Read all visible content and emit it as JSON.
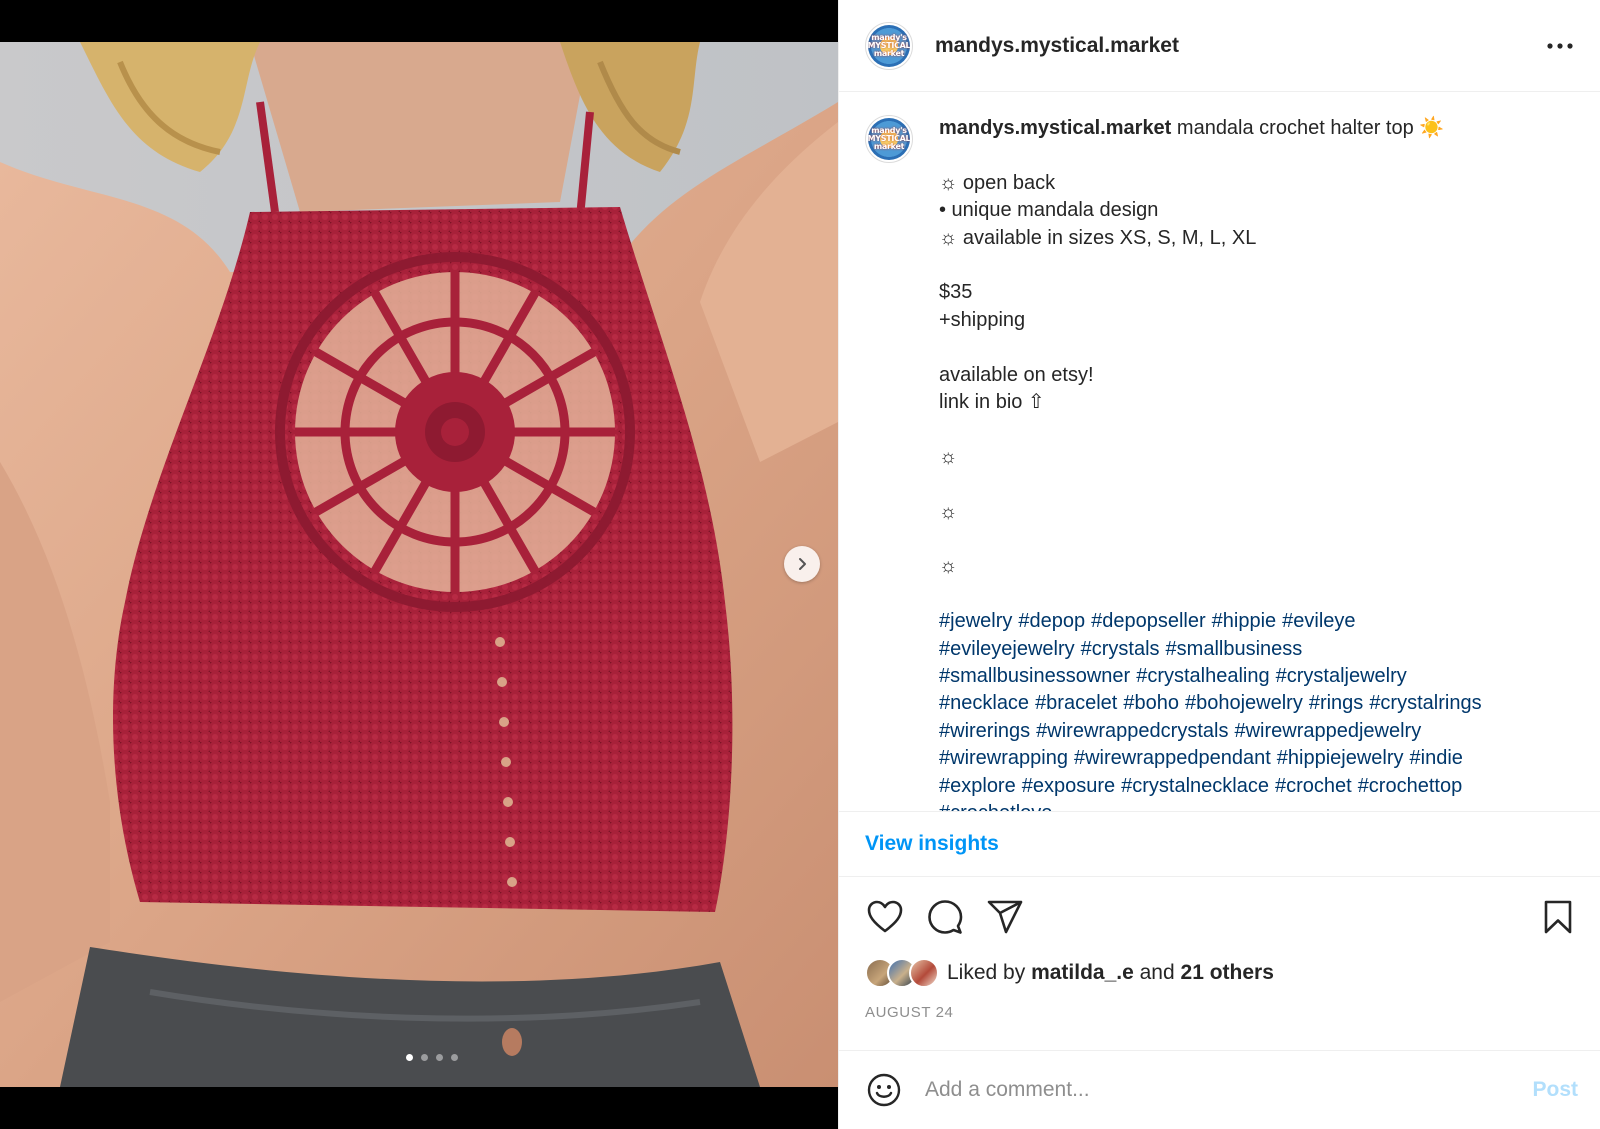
{
  "post": {
    "username": "mandys.mystical.market",
    "avatar_text": [
      "mandy's",
      "MYSTICAL",
      "market"
    ],
    "more_icon": "more-horizontal-icon",
    "next_icon": "chevron-right-icon",
    "carousel": {
      "count": 4,
      "active_index": 0
    }
  },
  "caption": {
    "username": "mandys.mystical.market",
    "title": "mandala crochet halter top ☀️",
    "lines": [
      "☼ open back",
      "• unique mandala design",
      "☼ available in sizes XS, S, M, L, XL",
      "",
      "$35",
      "+shipping",
      "",
      "available on etsy!",
      "link in bio ⇧",
      "",
      "☼",
      "",
      "☼",
      "",
      "☼",
      ""
    ],
    "hashtag_lines": [
      [
        "#jewelry",
        "#depop",
        "#depopseller",
        "#hippie",
        "#evileye"
      ],
      [
        "#evileyejewelry",
        "#crystals",
        "#smallbusiness"
      ],
      [
        "#smallbusinessowner",
        "#crystalhealing",
        "#crystaljewelry"
      ],
      [
        "#necklace",
        "#bracelet",
        "#boho",
        "#bohojewelry",
        "#rings",
        "#crystalrings"
      ],
      [
        "#wirerings",
        "#wirewrappedcrystals",
        "#wirewrappedjewelry"
      ],
      [
        "#wirewrapping",
        "#wirewrappedpendant",
        "#hippiejewelry",
        "#indie"
      ],
      [
        "#explore",
        "#exposure",
        "#crystalnecklace",
        "#crochet",
        "#crochettop"
      ],
      [
        "#crochetlove"
      ]
    ]
  },
  "insights": {
    "label": "View insights"
  },
  "actions": {
    "like_icon": "heart-icon",
    "comment_icon": "comment-icon",
    "share_icon": "send-icon",
    "save_icon": "bookmark-icon"
  },
  "likes": {
    "prefix": "Liked by",
    "first_user": "matilda_.e",
    "joiner": "and",
    "others": "21 others"
  },
  "date": "AUGUST 24",
  "comment": {
    "placeholder": "Add a comment...",
    "post_label": "Post",
    "emoji_icon": "smiley-icon"
  },
  "colors": {
    "link_blue": "#0095f6",
    "hashtag_blue": "#00376b",
    "post_disabled": "#b2dffc",
    "crochet_red": "#a8213a"
  }
}
